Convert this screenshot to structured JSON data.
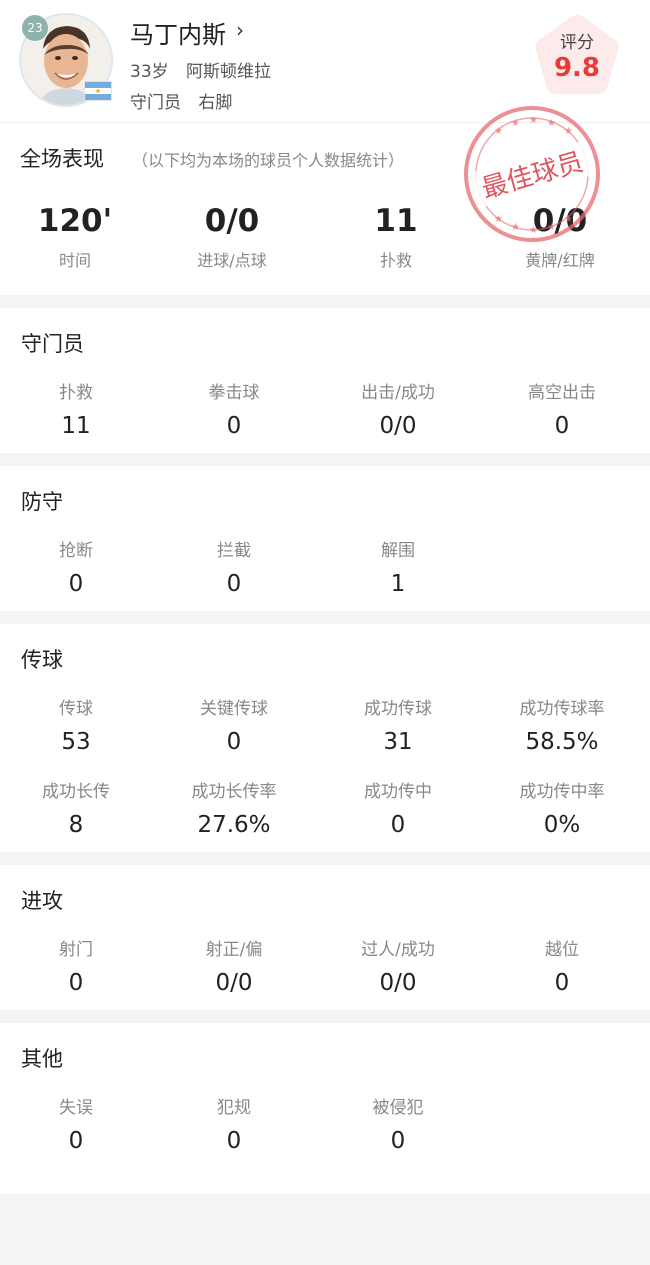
{
  "player": {
    "number": "23",
    "name": "马丁内斯",
    "chevron": "›",
    "age": "33岁",
    "club": "阿斯顿维拉",
    "position": "守门员",
    "foot": "右脚",
    "flag_icon": "argentina-flag-icon"
  },
  "rating": {
    "label": "评分",
    "value": "9.8",
    "color": "#ea3b3b"
  },
  "overview": {
    "title": "全场表现",
    "note": "（以下均为本场的球员个人数据统计）",
    "stamp_text": "最佳球员",
    "stats": [
      {
        "value": "120'",
        "label": "时间"
      },
      {
        "value": "0/0",
        "label": "进球/点球"
      },
      {
        "value": "11",
        "label": "扑救"
      },
      {
        "value": "0/0",
        "label": "黄牌/红牌"
      }
    ]
  },
  "sections": {
    "goalkeeper": {
      "title": "守门员",
      "rows": [
        [
          {
            "label": "扑救",
            "value": "11"
          },
          {
            "label": "拳击球",
            "value": "0"
          },
          {
            "label": "出击/成功",
            "value": "0/0"
          },
          {
            "label": "高空出击",
            "value": "0"
          }
        ]
      ]
    },
    "defense": {
      "title": "防守",
      "rows": [
        [
          {
            "label": "抢断",
            "value": "0"
          },
          {
            "label": "拦截",
            "value": "0"
          },
          {
            "label": "解围",
            "value": "1"
          }
        ]
      ]
    },
    "passing": {
      "title": "传球",
      "rows": [
        [
          {
            "label": "传球",
            "value": "53"
          },
          {
            "label": "关键传球",
            "value": "0"
          },
          {
            "label": "成功传球",
            "value": "31"
          },
          {
            "label": "成功传球率",
            "value": "58.5%"
          }
        ],
        [
          {
            "label": "成功长传",
            "value": "8"
          },
          {
            "label": "成功长传率",
            "value": "27.6%"
          },
          {
            "label": "成功传中",
            "value": "0"
          },
          {
            "label": "成功传中率",
            "value": "0%"
          }
        ]
      ]
    },
    "attack": {
      "title": "进攻",
      "rows": [
        [
          {
            "label": "射门",
            "value": "0"
          },
          {
            "label": "射正/偏",
            "value": "0/0"
          },
          {
            "label": "过人/成功",
            "value": "0/0"
          },
          {
            "label": "越位",
            "value": "0"
          }
        ]
      ]
    },
    "other": {
      "title": "其他",
      "rows": [
        [
          {
            "label": "失误",
            "value": "0"
          },
          {
            "label": "犯规",
            "value": "0"
          },
          {
            "label": "被侵犯",
            "value": "0"
          }
        ]
      ]
    }
  }
}
